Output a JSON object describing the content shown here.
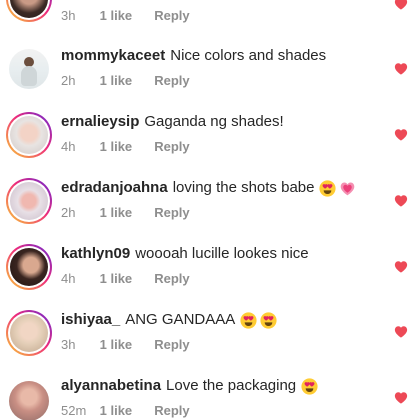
{
  "colors": {
    "heart": "#ed4956",
    "username": "#262626",
    "meta": "#8e8e8e"
  },
  "comments": [
    {
      "username": "",
      "text": "",
      "time": "3h",
      "likes": "1 like",
      "reply": "Reply",
      "emojis": []
    },
    {
      "username": "mommykaceet",
      "text": "Nice colors and shades",
      "time": "2h",
      "likes": "1 like",
      "reply": "Reply",
      "emojis": []
    },
    {
      "username": "ernalieysip",
      "text": "Gaganda ng shades!",
      "time": "4h",
      "likes": "1 like",
      "reply": "Reply",
      "emojis": []
    },
    {
      "username": "edradanjoahna",
      "text": "loving the shots babe",
      "time": "2h",
      "likes": "1 like",
      "reply": "Reply",
      "emojis": [
        "heart-eyes-emoji",
        "growing-heart-emoji"
      ]
    },
    {
      "username": "kathlyn09",
      "text": "woooah lucille lookes nice",
      "time": "4h",
      "likes": "1 like",
      "reply": "Reply",
      "emojis": []
    },
    {
      "username": "ishiyaa_",
      "text": "ANG GANDAAA",
      "time": "3h",
      "likes": "1 like",
      "reply": "Reply",
      "emojis": [
        "heart-eyes-emoji",
        "heart-eyes-emoji"
      ]
    },
    {
      "username": "alyannabetina",
      "text": "Love the packaging",
      "time": "52m",
      "likes": "1 like",
      "reply": "Reply",
      "emojis": [
        "heart-eyes-emoji"
      ]
    }
  ]
}
